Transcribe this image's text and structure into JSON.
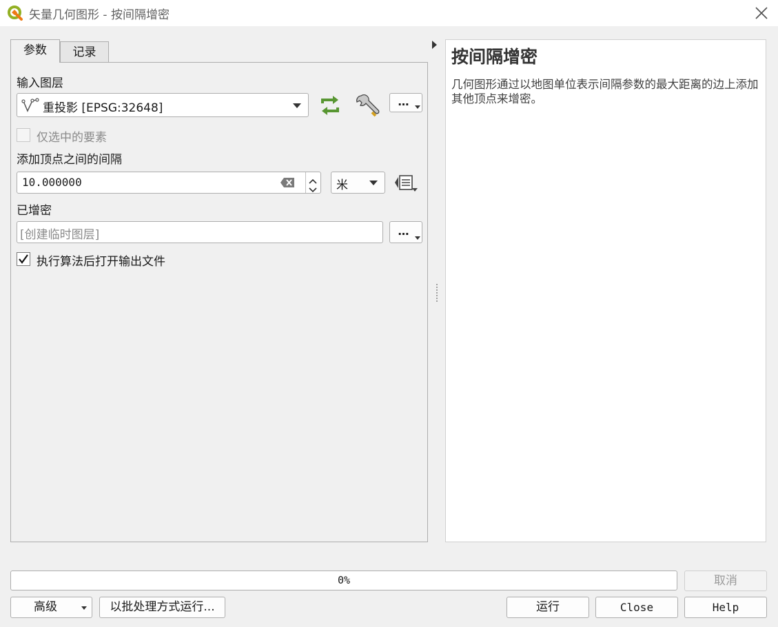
{
  "window": {
    "title": "矢量几何图形 - 按间隔增密",
    "close_icon": "close-icon"
  },
  "tabs": [
    {
      "label": "参数",
      "active": true
    },
    {
      "label": "记录",
      "active": false
    }
  ],
  "params": {
    "input_layer_label": "输入图层",
    "input_layer_value": "重投影 [EPSG:32648]",
    "selected_only_label": "仅选中的要素",
    "selected_only_checked": false,
    "interval_label": "添加顶点之间的间隔",
    "interval_value": "10.000000",
    "unit_value": "米",
    "output_label": "已增密",
    "output_placeholder": "[创建临时图层]",
    "open_output_label": "执行算法后打开输出文件",
    "open_output_checked": true,
    "more_label": "…"
  },
  "help": {
    "title": "按间隔增密",
    "body": "几何图形通过以地图单位表示间隔参数的最大距离的边上添加其他顶点来增密。"
  },
  "footer": {
    "progress_text": "0%",
    "progress_value": 0,
    "cancel_label": "取消",
    "advanced_label": "高级",
    "batch_label": "以批处理方式运行...",
    "run_label": "运行",
    "close_label": "Close",
    "help_label": "Help"
  },
  "colors": {
    "accent_green": "#589632",
    "logo_yellow": "#ee7913"
  }
}
